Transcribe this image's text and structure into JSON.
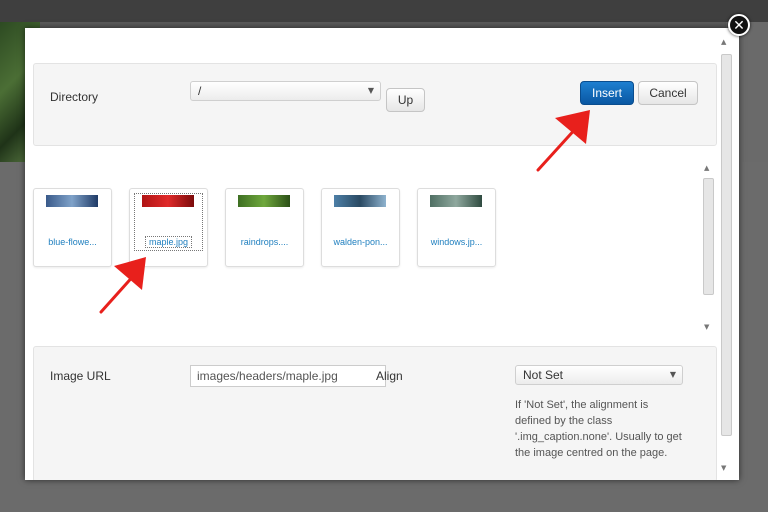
{
  "directory": {
    "label": "Directory",
    "value": "/",
    "up_label": "Up"
  },
  "actions": {
    "insert_label": "Insert",
    "cancel_label": "Cancel"
  },
  "close": {
    "glyph": "✕"
  },
  "images": [
    {
      "name": "blue-flowe...",
      "colors": [
        "#3a5a8a",
        "#7fa2c9",
        "#1f3a66"
      ]
    },
    {
      "name": "maple.jpg",
      "colors": [
        "#b01414",
        "#e02a2a",
        "#7a0a0a"
      ],
      "selected": true
    },
    {
      "name": "raindrops....",
      "colors": [
        "#3e6f22",
        "#6fa83d",
        "#2b4f16"
      ]
    },
    {
      "name": "walden-pon...",
      "colors": [
        "#4d7fa7",
        "#2a4a63",
        "#8fb3cf"
      ]
    },
    {
      "name": "windows.jp...",
      "colors": [
        "#4f6f63",
        "#8fa89e",
        "#2f4b40"
      ]
    }
  ],
  "image_url": {
    "label": "Image URL",
    "value": "images/headers/maple.jpg"
  },
  "align": {
    "label": "Align",
    "value": "Not Set",
    "help": "If 'Not Set', the alignment is defined by the class '.img_caption.none'. Usually to get the image centred on the page."
  },
  "icons": {
    "close": "close-icon",
    "dropdown": "chevron-down-icon",
    "scroll_up": "scroll-up-icon",
    "scroll_down": "scroll-down-icon"
  },
  "colors": {
    "accent": "#0a57a2",
    "annotation": "#e8201c"
  }
}
